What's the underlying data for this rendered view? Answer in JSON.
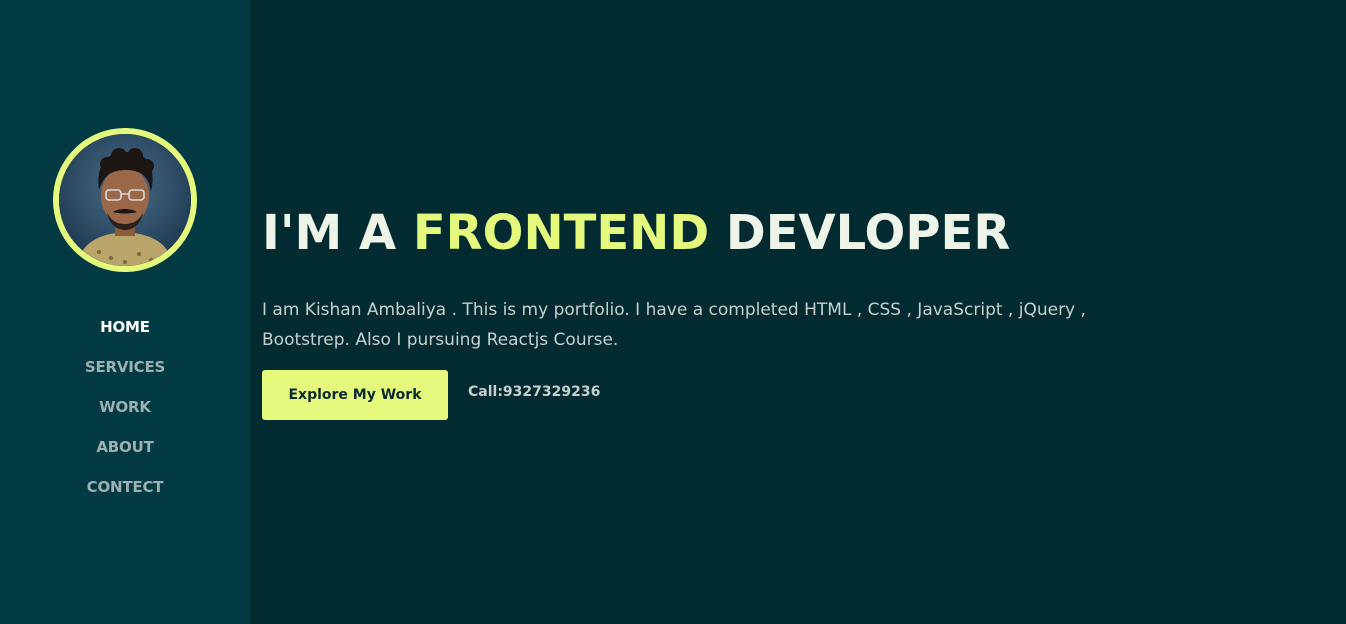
{
  "sidebar": {
    "avatar_icon": "profile-photo",
    "nav": [
      {
        "label": "HOME",
        "active": true
      },
      {
        "label": "SERVICES",
        "active": false
      },
      {
        "label": "WORK",
        "active": false
      },
      {
        "label": "ABOUT",
        "active": false
      },
      {
        "label": "CONTECT",
        "active": false
      }
    ]
  },
  "hero": {
    "title_prefix": "I'M A ",
    "title_highlight": "FRONTEND",
    "title_suffix": " DEVLOPER",
    "description": "I am Kishan Ambaliya . This is my portfolio. I have a completed HTML , CSS , JavaScript , jQuery , Bootstrep. Also I pursuing Reactjs Course.",
    "cta_label": "Explore My Work",
    "call_text": "Call:9327329236"
  },
  "colors": {
    "background": "#022b31",
    "sidebar_background": "#013a42",
    "accent": "#e5fa7d",
    "heading_text": "#eef4e8",
    "body_text": "#c5d0cf",
    "nav_inactive": "#9fb0b2",
    "nav_active": "#ffffff"
  }
}
